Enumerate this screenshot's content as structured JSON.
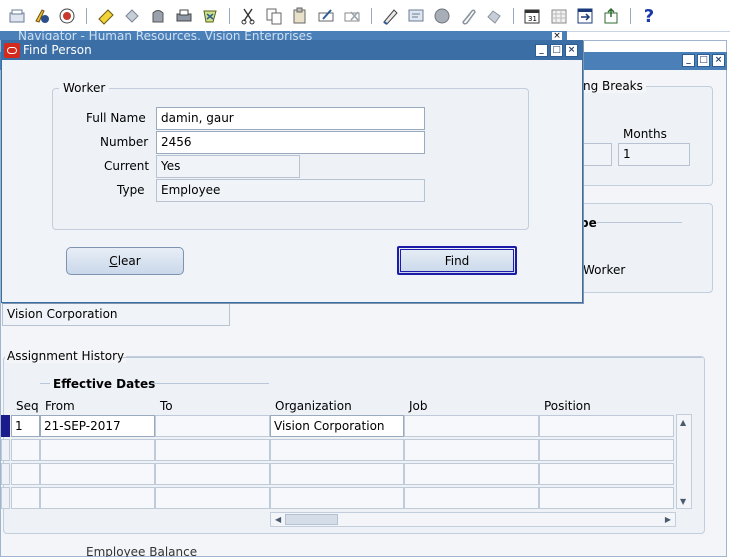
{
  "toolbar": {
    "icons": [
      "new-icon",
      "open-folder-icon",
      "save-icon",
      "next-step-icon",
      "print-icon",
      "close-form-icon",
      "cut-icon",
      "copy-icon",
      "paste-icon",
      "clear-record-icon",
      "delete-record-icon",
      "edit-field-icon",
      "zoom-icon",
      "translations-icon",
      "attachments-icon",
      "folder-tools-icon",
      "calendar-icon",
      "work-schedule-icon",
      "window-icon",
      "export-icon",
      "help-icon"
    ],
    "help_glyph": "?"
  },
  "navigator": {
    "title": "Navigator - Human Resources, Vision Enterprises",
    "close_glyph": "×"
  },
  "people_window": {
    "window_buttons": [
      "_",
      "□",
      "×"
    ],
    "breaks_label": "ng Breaks",
    "months_label": "Months",
    "months_value": "1",
    "section_label_fragment": "pe",
    "worker_label_fragment": "Worker",
    "organization_value": "Vision Corporation",
    "assignment_history_label": "Assignment History",
    "effective_dates_label": "Effective Dates",
    "columns": [
      "Seq",
      "From",
      "To",
      "Organization",
      "Job",
      "Position"
    ],
    "rows": [
      {
        "seq": "1",
        "from": "21-SEP-2017",
        "to": "",
        "organization": "Vision Corporation",
        "job": "",
        "position": ""
      },
      {
        "seq": "",
        "from": "",
        "to": "",
        "organization": "",
        "job": "",
        "position": ""
      },
      {
        "seq": "",
        "from": "",
        "to": "",
        "organization": "",
        "job": "",
        "position": ""
      },
      {
        "seq": "",
        "from": "",
        "to": "",
        "organization": "",
        "job": "",
        "position": ""
      }
    ],
    "bottom_fragment": "Employee Balance"
  },
  "find_person": {
    "title": "Find Person",
    "window_buttons": [
      "_",
      "□",
      "×"
    ],
    "group_label": "Worker",
    "full_name_label": "Full Name",
    "full_name_value": "damin, gaur",
    "number_label": "Number",
    "number_value": "2456",
    "current_label": "Current",
    "current_value": "Yes",
    "type_label": "Type",
    "type_value": "Employee",
    "clear_button": "Clear",
    "find_button": "Find"
  },
  "colors": {
    "title_bar": "#3a6ea5",
    "accent_row": "#1a1a8c",
    "oracle_red": "#d42a1e"
  }
}
